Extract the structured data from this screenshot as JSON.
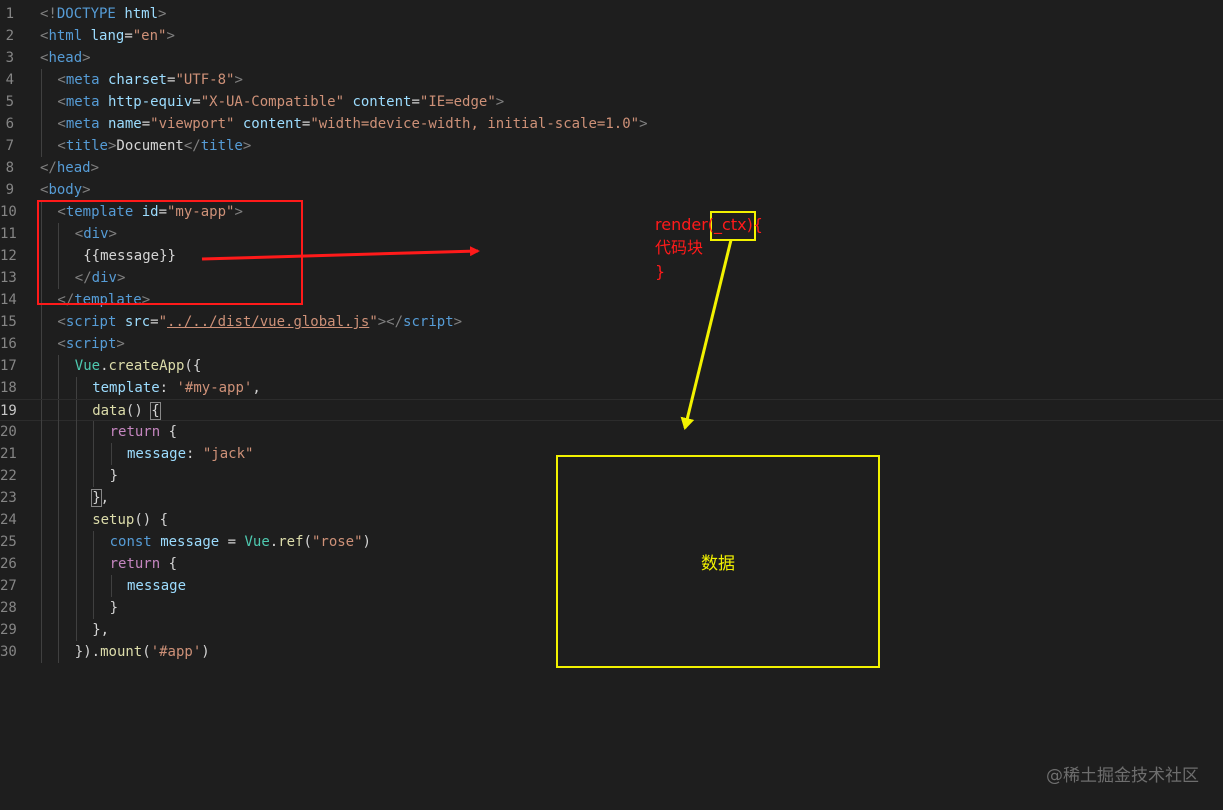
{
  "editor": {
    "active_line": 19,
    "lines": [
      {
        "num": "1",
        "indent": 0,
        "tokens": [
          [
            "punc",
            "<!"
          ],
          [
            "tag",
            "DOCTYPE"
          ],
          [
            "text",
            " "
          ],
          [
            "attr",
            "html"
          ],
          [
            "punc",
            ">"
          ]
        ]
      },
      {
        "num": "2",
        "indent": 0,
        "tokens": [
          [
            "punc",
            "<"
          ],
          [
            "tag",
            "html"
          ],
          [
            "text",
            " "
          ],
          [
            "attr",
            "lang"
          ],
          [
            "text",
            "="
          ],
          [
            "str",
            "\"en\""
          ],
          [
            "punc",
            ">"
          ]
        ]
      },
      {
        "num": "3",
        "indent": 0,
        "tokens": [
          [
            "punc",
            "<"
          ],
          [
            "tag",
            "head"
          ],
          [
            "punc",
            ">"
          ]
        ]
      },
      {
        "num": "4",
        "indent": 1,
        "tokens": [
          [
            "punc",
            "<"
          ],
          [
            "tag",
            "meta"
          ],
          [
            "text",
            " "
          ],
          [
            "attr",
            "charset"
          ],
          [
            "text",
            "="
          ],
          [
            "str",
            "\"UTF-8\""
          ],
          [
            "punc",
            ">"
          ]
        ]
      },
      {
        "num": "5",
        "indent": 1,
        "tokens": [
          [
            "punc",
            "<"
          ],
          [
            "tag",
            "meta"
          ],
          [
            "text",
            " "
          ],
          [
            "attr",
            "http-equiv"
          ],
          [
            "text",
            "="
          ],
          [
            "str",
            "\"X-UA-Compatible\""
          ],
          [
            "text",
            " "
          ],
          [
            "attr",
            "content"
          ],
          [
            "text",
            "="
          ],
          [
            "str",
            "\"IE=edge\""
          ],
          [
            "punc",
            ">"
          ]
        ]
      },
      {
        "num": "6",
        "indent": 1,
        "tokens": [
          [
            "punc",
            "<"
          ],
          [
            "tag",
            "meta"
          ],
          [
            "text",
            " "
          ],
          [
            "attr",
            "name"
          ],
          [
            "text",
            "="
          ],
          [
            "str",
            "\"viewport\""
          ],
          [
            "text",
            " "
          ],
          [
            "attr",
            "content"
          ],
          [
            "text",
            "="
          ],
          [
            "str",
            "\"width=device-width, initial-scale=1.0\""
          ],
          [
            "punc",
            ">"
          ]
        ]
      },
      {
        "num": "7",
        "indent": 1,
        "tokens": [
          [
            "punc",
            "<"
          ],
          [
            "tag",
            "title"
          ],
          [
            "punc",
            ">"
          ],
          [
            "text",
            "Document"
          ],
          [
            "punc",
            "</"
          ],
          [
            "tag",
            "title"
          ],
          [
            "punc",
            ">"
          ]
        ]
      },
      {
        "num": "8",
        "indent": 0,
        "tokens": [
          [
            "punc",
            "</"
          ],
          [
            "tag",
            "head"
          ],
          [
            "punc",
            ">"
          ]
        ]
      },
      {
        "num": "9",
        "indent": 0,
        "tokens": [
          [
            "punc",
            "<"
          ],
          [
            "tag",
            "body"
          ],
          [
            "punc",
            ">"
          ]
        ]
      },
      {
        "num": "10",
        "indent": 1,
        "tokens": [
          [
            "punc",
            "<"
          ],
          [
            "tag",
            "template"
          ],
          [
            "text",
            " "
          ],
          [
            "attr",
            "id"
          ],
          [
            "text",
            "="
          ],
          [
            "str",
            "\"my-app\""
          ],
          [
            "punc",
            ">"
          ]
        ]
      },
      {
        "num": "11",
        "indent": 2,
        "tokens": [
          [
            "punc",
            "<"
          ],
          [
            "tag",
            "div"
          ],
          [
            "punc",
            ">"
          ]
        ]
      },
      {
        "num": "12",
        "indent": 2,
        "tokens": [
          [
            "text",
            " {{message}}"
          ]
        ]
      },
      {
        "num": "13",
        "indent": 2,
        "tokens": [
          [
            "punc",
            "</"
          ],
          [
            "tag",
            "div"
          ],
          [
            "punc",
            ">"
          ]
        ]
      },
      {
        "num": "14",
        "indent": 1,
        "tokens": [
          [
            "punc",
            "</"
          ],
          [
            "tag",
            "template"
          ],
          [
            "punc",
            ">"
          ]
        ]
      },
      {
        "num": "15",
        "indent": 1,
        "tokens": [
          [
            "punc",
            "<"
          ],
          [
            "tag",
            "script"
          ],
          [
            "text",
            " "
          ],
          [
            "attr",
            "src"
          ],
          [
            "text",
            "="
          ],
          [
            "str",
            "\""
          ],
          [
            "url",
            "../../dist/vue.global.js"
          ],
          [
            "str",
            "\""
          ],
          [
            "punc",
            "></"
          ],
          [
            "tag",
            "script"
          ],
          [
            "punc",
            ">"
          ]
        ]
      },
      {
        "num": "16",
        "indent": 1,
        "tokens": [
          [
            "punc",
            "<"
          ],
          [
            "tag",
            "script"
          ],
          [
            "punc",
            ">"
          ]
        ]
      },
      {
        "num": "17",
        "indent": 2,
        "tokens": [
          [
            "obj",
            "Vue"
          ],
          [
            "text",
            "."
          ],
          [
            "fn",
            "createApp"
          ],
          [
            "text",
            "({"
          ]
        ]
      },
      {
        "num": "18",
        "indent": 3,
        "tokens": [
          [
            "var",
            "template"
          ],
          [
            "text",
            ": "
          ],
          [
            "str",
            "'#my-app'"
          ],
          [
            "text",
            ","
          ]
        ]
      },
      {
        "num": "19",
        "indent": 3,
        "tokens": [
          [
            "fn",
            "data"
          ],
          [
            "text",
            "() "
          ],
          [
            "box",
            "{"
          ]
        ]
      },
      {
        "num": "20",
        "indent": 4,
        "tokens": [
          [
            "ctrl",
            "return"
          ],
          [
            "text",
            " {"
          ]
        ]
      },
      {
        "num": "21",
        "indent": 5,
        "tokens": [
          [
            "var",
            "message"
          ],
          [
            "text",
            ": "
          ],
          [
            "str",
            "\"jack\""
          ]
        ]
      },
      {
        "num": "22",
        "indent": 4,
        "tokens": [
          [
            "text",
            "}"
          ]
        ]
      },
      {
        "num": "23",
        "indent": 3,
        "tokens": [
          [
            "box",
            "}"
          ],
          [
            "text",
            ","
          ]
        ]
      },
      {
        "num": "24",
        "indent": 3,
        "tokens": [
          [
            "fn",
            "setup"
          ],
          [
            "text",
            "() {"
          ]
        ]
      },
      {
        "num": "25",
        "indent": 4,
        "tokens": [
          [
            "kw",
            "const"
          ],
          [
            "text",
            " "
          ],
          [
            "var",
            "message"
          ],
          [
            "text",
            " = "
          ],
          [
            "obj",
            "Vue"
          ],
          [
            "text",
            "."
          ],
          [
            "fn",
            "ref"
          ],
          [
            "text",
            "("
          ],
          [
            "str",
            "\"rose\""
          ],
          [
            "text",
            ")"
          ]
        ]
      },
      {
        "num": "26",
        "indent": 4,
        "tokens": [
          [
            "ctrl",
            "return"
          ],
          [
            "text",
            " {"
          ]
        ]
      },
      {
        "num": "27",
        "indent": 5,
        "tokens": [
          [
            "var",
            "message"
          ]
        ]
      },
      {
        "num": "28",
        "indent": 4,
        "tokens": [
          [
            "text",
            "}"
          ]
        ]
      },
      {
        "num": "29",
        "indent": 3,
        "tokens": [
          [
            "text",
            "},"
          ]
        ]
      },
      {
        "num": "30",
        "indent": 2,
        "tokens": [
          [
            "text",
            "})."
          ],
          [
            "fn",
            "mount"
          ],
          [
            "text",
            "("
          ],
          [
            "str",
            "'#app'"
          ],
          [
            "text",
            ")"
          ]
        ]
      }
    ]
  },
  "annotations": {
    "render_line": "render(_ctx){",
    "code_block_line": "代码块",
    "close_brace_line": "}",
    "data_box_label": "数据",
    "red_color": "#ff1a1a",
    "yellow_color": "#f2f200"
  },
  "watermark": "@稀土掘金技术社区"
}
